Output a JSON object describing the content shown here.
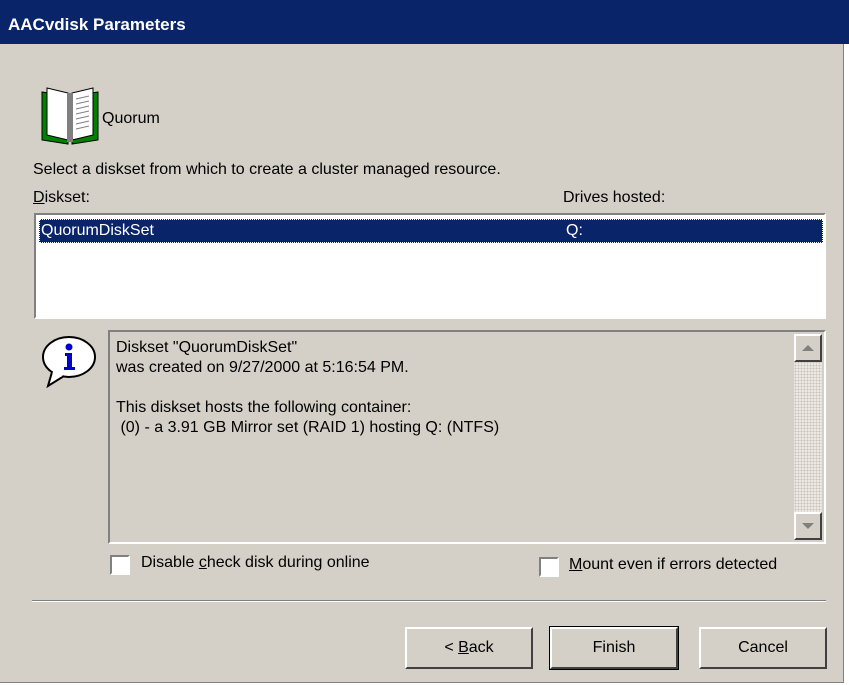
{
  "window": {
    "title": "AACvdisk Parameters"
  },
  "header": {
    "resource_name": "Quorum",
    "icon": "book-icon"
  },
  "instructions": "Select a diskset from which to create a cluster managed resource.",
  "list": {
    "col_diskset": {
      "pre": "",
      "mnemonic": "D",
      "post": "iskset:"
    },
    "col_drives": "Drives hosted:",
    "rows": [
      {
        "diskset": "QuorumDiskSet",
        "drives": "Q:"
      }
    ]
  },
  "info_box": {
    "icon": "info-icon",
    "lines": [
      "Diskset \"QuorumDiskSet\"",
      "was created on 9/27/2000 at 5:16:54 PM.",
      "",
      "This diskset hosts the following container:",
      " (0) - a 3.91 GB Mirror set (RAID 1) hosting Q: (NTFS)"
    ]
  },
  "options": {
    "disable_check": {
      "pre": "Disable ",
      "mnemonic": "c",
      "post": "heck disk during online",
      "checked": false
    },
    "mount_errors": {
      "pre": "",
      "mnemonic": "M",
      "post": "ount even if errors detected",
      "checked": false
    }
  },
  "buttons": {
    "back": {
      "pre": "< ",
      "mnemonic": "B",
      "post": "ack"
    },
    "finish": "Finish",
    "cancel": "Cancel"
  },
  "colors": {
    "titlebar": "#0a246a",
    "face": "#d4d0c8",
    "selection": "#0a246a"
  }
}
